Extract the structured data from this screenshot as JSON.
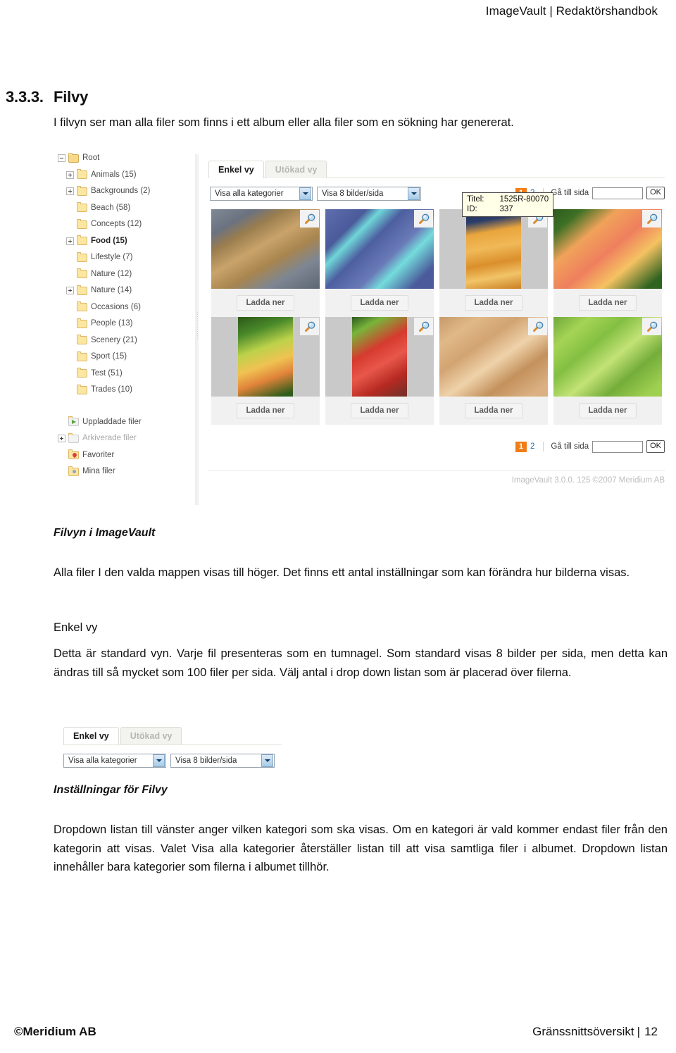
{
  "header": {
    "title": "ImageVault | Redaktörshandbok"
  },
  "section": {
    "number": "3.3.3.",
    "title": "Filvy",
    "intro": "I filvyn ser man alla filer som finns i ett album eller alla filer som en sökning har genererat."
  },
  "screenshot": {
    "tree": {
      "items": [
        {
          "label": "Root",
          "level": 0,
          "expander": "minus",
          "icon": "folder-root-icon",
          "style": "normal"
        },
        {
          "label": "Animals (15)",
          "level": 1,
          "expander": "plus",
          "icon": "folder-icon",
          "style": "normal"
        },
        {
          "label": "Backgrounds (2)",
          "level": 1,
          "expander": "plus",
          "icon": "folder-icon",
          "style": "normal"
        },
        {
          "label": "Beach (58)",
          "level": 1,
          "expander": "none",
          "icon": "folder-icon",
          "style": "normal"
        },
        {
          "label": "Concepts (12)",
          "level": 1,
          "expander": "none",
          "icon": "folder-icon",
          "style": "normal"
        },
        {
          "label": "Food (15)",
          "level": 1,
          "expander": "plus",
          "icon": "folder-icon",
          "style": "bold"
        },
        {
          "label": "Lifestyle (7)",
          "level": 1,
          "expander": "none",
          "icon": "folder-icon",
          "style": "normal"
        },
        {
          "label": "Nature (12)",
          "level": 1,
          "expander": "none",
          "icon": "folder-icon",
          "style": "normal"
        },
        {
          "label": "Nature (14)",
          "level": 1,
          "expander": "plus",
          "icon": "folder-icon",
          "style": "normal"
        },
        {
          "label": "Occasions (6)",
          "level": 1,
          "expander": "none",
          "icon": "folder-icon",
          "style": "normal"
        },
        {
          "label": "People (13)",
          "level": 1,
          "expander": "none",
          "icon": "folder-icon",
          "style": "normal"
        },
        {
          "label": "Scenery (21)",
          "level": 1,
          "expander": "none",
          "icon": "folder-icon",
          "style": "normal"
        },
        {
          "label": "Sport (15)",
          "level": 1,
          "expander": "none",
          "icon": "folder-icon",
          "style": "normal"
        },
        {
          "label": "Test (51)",
          "level": 1,
          "expander": "none",
          "icon": "folder-icon",
          "style": "normal"
        },
        {
          "label": "Trades (10)",
          "level": 1,
          "expander": "none",
          "icon": "folder-icon",
          "style": "normal"
        }
      ],
      "special": [
        {
          "label": "Uppladdade filer",
          "expander": "none",
          "icon": "uploaded-files-icon",
          "style": "normal"
        },
        {
          "label": "Arkiverade filer",
          "expander": "plus",
          "icon": "archived-files-icon",
          "style": "dim"
        },
        {
          "label": "Favoriter",
          "expander": "none",
          "icon": "favorites-icon",
          "style": "normal"
        },
        {
          "label": "Mina filer",
          "expander": "none",
          "icon": "my-files-icon",
          "style": "normal"
        }
      ]
    },
    "tabs": [
      {
        "label": "Enkel vy",
        "active": true
      },
      {
        "label": "Utökad vy",
        "active": false
      }
    ],
    "dropdowns": [
      {
        "value": "Visa alla kategorier"
      },
      {
        "value": "Visa 8 bilder/sida"
      }
    ],
    "pager": {
      "current": "1",
      "next": "2",
      "goto_label": "Gå till sida",
      "input_value": "",
      "ok_label": "OK"
    },
    "thumbnails": [
      {
        "download_label": "Ladda ner",
        "orientation": "wide",
        "alt": "gingerbread-cookies"
      },
      {
        "download_label": "Ladda ner",
        "orientation": "wide",
        "alt": "blueberry-baskets"
      },
      {
        "download_label": "Ladda ner",
        "orientation": "tall",
        "alt": "orange-tomatoes"
      },
      {
        "download_label": "Ladda ner",
        "orientation": "wide",
        "alt": "peaches"
      },
      {
        "download_label": "Ladda ner",
        "orientation": "tall",
        "alt": "green-apples"
      },
      {
        "download_label": "Ladda ner",
        "orientation": "tall",
        "alt": "red-apple"
      },
      {
        "download_label": "Ladda ner",
        "orientation": "wide",
        "alt": "potatoes"
      },
      {
        "download_label": "Ladda ner",
        "orientation": "wide",
        "alt": "celery"
      }
    ],
    "tooltip": {
      "title_key": "Titel:",
      "title_value": "1525R-80070",
      "id_key": "ID:",
      "id_value": "337"
    },
    "app_footer": "ImageVault 3.0.0. 125 ©2007 Meridium AB",
    "colors": {
      "pager_active_bg": "#f07d18",
      "link": "#1f6fb5",
      "thumb_bg": "#c9c9c9"
    }
  },
  "caption1": "Filvyn i ImageVault",
  "para1": "Alla filer I den valda mappen visas till höger. Det finns ett antal inställningar som kan förändra hur bilderna visas.",
  "subhead1": "Enkel vy",
  "para2": "Detta är standard vyn. Varje fil presenteras som en tumnagel. Som standard visas 8 bilder per sida, men detta kan ändras till så mycket som 100 filer per sida. Välj antal i drop down listan som är placerad över filerna.",
  "mini_shot": {
    "tabs": [
      {
        "label": "Enkel vy",
        "active": true
      },
      {
        "label": "Utökad vy",
        "active": false
      }
    ],
    "dropdowns": [
      {
        "value": "Visa alla kategorier"
      },
      {
        "value": "Visa 8 bilder/sida"
      }
    ]
  },
  "caption2": "Inställningar för Filvy",
  "para3": "Dropdown listan till vänster anger vilken kategori som ska visas. Om en kategori är vald kommer endast filer från den kategorin att visas. Valet Visa alla kategorier återställer listan till att visa samtliga filer i albumet. Dropdown listan innehåller bara kategorier som filerna i albumet tillhör.",
  "footer": {
    "left": "©Meridium AB",
    "right_label": "Gränssnittsöversikt",
    "separator": "|",
    "page_number": "12"
  }
}
